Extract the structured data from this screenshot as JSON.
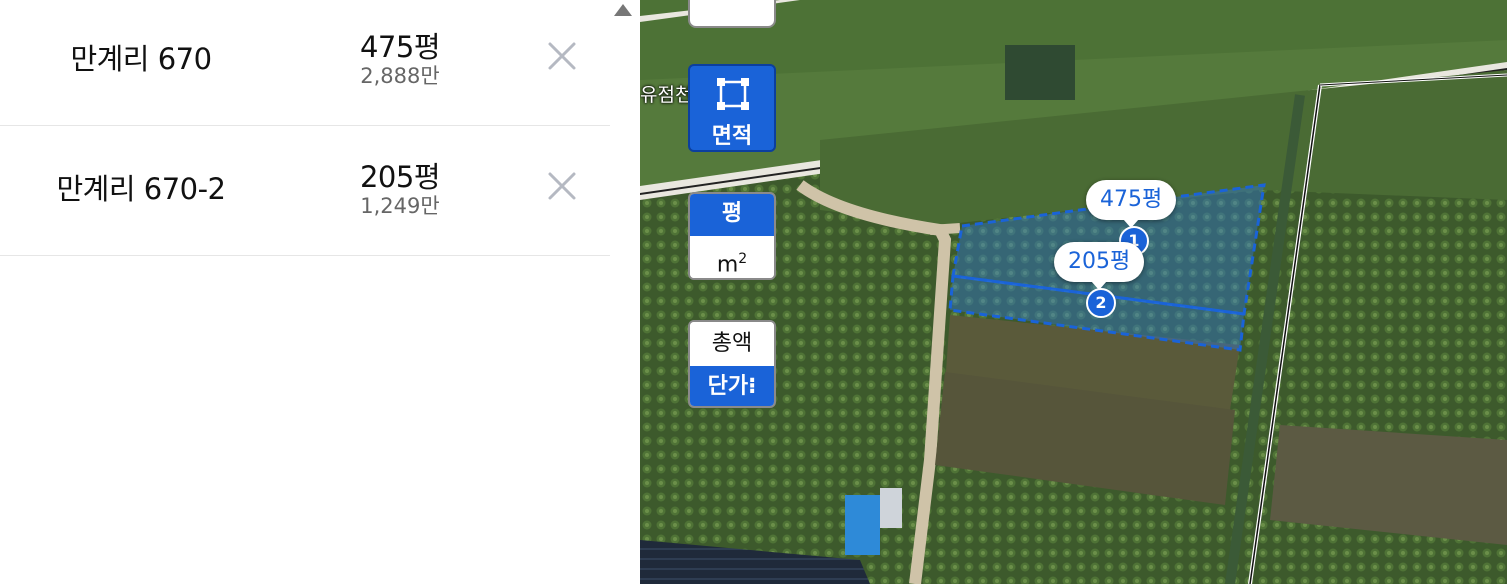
{
  "parcels": [
    {
      "address": "만계리 670",
      "area": "475평",
      "price": "2,888만"
    },
    {
      "address": "만계리 670-2",
      "area": "205평",
      "price": "1,249만"
    }
  ],
  "map": {
    "tools": {
      "area_label": "면적",
      "unit_pyeong": "평",
      "unit_m2_base": "m",
      "unit_m2_exp": "2",
      "total_label": "총액",
      "unit_price_label": "단가⁝"
    },
    "stream_label": "유점천",
    "markers": [
      {
        "number": "1",
        "area": "475평"
      },
      {
        "number": "2",
        "area": "205평"
      }
    ]
  },
  "colors": {
    "accent": "#1a63d8",
    "delete": "#b5b9c2"
  }
}
